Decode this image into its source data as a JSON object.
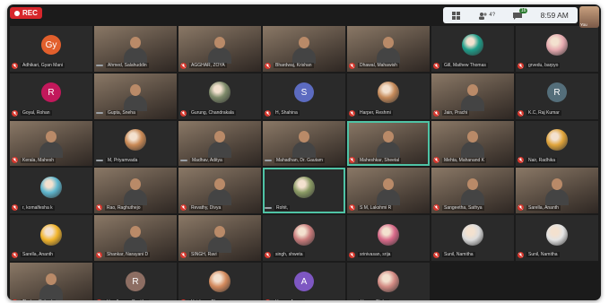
{
  "meeting": {
    "rec_label": "REC",
    "clock": "8:59 AM",
    "self_label": "You",
    "toolbar_icons": [
      "grid-view-icon",
      "participants-icon",
      "chat-icon"
    ],
    "participant_count": "4?",
    "chat_badge": "16"
  },
  "tiles": [
    {
      "name": "Adhikari, Gyan Mani",
      "type": "avatar",
      "initials": "Gy",
      "color": "#e25f2c",
      "muted": true
    },
    {
      "name": "Ahmed, Salahuddin",
      "type": "cam",
      "muted": false
    },
    {
      "name": "AGGHAR, ZOYA",
      "type": "cam",
      "muted": true
    },
    {
      "name": "Bhardwaj, Krishan",
      "type": "cam",
      "muted": true
    },
    {
      "name": "Dhawal, Mahawish",
      "type": "cam",
      "muted": true
    },
    {
      "name": "Gill, Mathew Thomas",
      "type": "picture",
      "color": "#1f9e8a",
      "muted": true
    },
    {
      "name": "grvedu, barpyo",
      "type": "picture",
      "color": "#e6aab0",
      "muted": true
    },
    {
      "name": "Goyal, Rohan",
      "type": "avatar",
      "initials": "R",
      "color": "#c2185b",
      "muted": true
    },
    {
      "name": "Gupta, Sneha",
      "type": "cam",
      "muted": false
    },
    {
      "name": "Gurung, Chandrakala",
      "type": "picture",
      "color": "#7d8a6a",
      "muted": true
    },
    {
      "name": "H, Shahina",
      "type": "avatar",
      "initials": "S",
      "color": "#5c6bc0",
      "muted": true
    },
    {
      "name": "Harper, Reshmi",
      "type": "picture",
      "color": "#c58a5a",
      "muted": true
    },
    {
      "name": "Jain, Prachi",
      "type": "cam",
      "muted": true
    },
    {
      "name": "K.C, Raj Kumar",
      "type": "avatar",
      "initials": "R",
      "color": "#546e7a",
      "muted": true
    },
    {
      "name": "Kerala, Mahesh",
      "type": "cam",
      "muted": true
    },
    {
      "name": "M, Priyamvada",
      "type": "picture",
      "color": "#c98955",
      "muted": false
    },
    {
      "name": "Madhav, Aditya",
      "type": "cam",
      "muted": false
    },
    {
      "name": "Mahadhan, Dr. Gautam",
      "type": "cam",
      "muted": false
    },
    {
      "name": "Maheshkar, Sheetal",
      "type": "cam",
      "muted": true,
      "highlight": true
    },
    {
      "name": "Mehta, Mahanand K",
      "type": "cam",
      "muted": true
    },
    {
      "name": "Nair, Radhika",
      "type": "picture",
      "color": "#e0a43a",
      "muted": true
    },
    {
      "name": "r, komalfesha k",
      "type": "picture",
      "color": "#5fb7cf",
      "muted": true
    },
    {
      "name": "Rao, Raghuthejo",
      "type": "cam",
      "muted": true
    },
    {
      "name": "Revathy, Divya",
      "type": "cam",
      "muted": true
    },
    {
      "name": "Rohit,",
      "type": "picture",
      "color": "#8a9a64",
      "muted": false,
      "highlight": true
    },
    {
      "name": "S M, Lakshmi R",
      "type": "cam",
      "muted": true
    },
    {
      "name": "Sangeetha, Sathya",
      "type": "cam",
      "muted": true
    },
    {
      "name": "Sarella, Ananth",
      "type": "cam",
      "muted": true
    },
    {
      "name": "Sarella, Ananth",
      "type": "picture",
      "color": "#f2b52c",
      "muted": true
    },
    {
      "name": "Shankar, Narayani D",
      "type": "cam",
      "muted": true
    },
    {
      "name": "SINGH, Ravi",
      "type": "cam",
      "muted": true
    },
    {
      "name": "singh, shweta",
      "type": "picture",
      "color": "#c87b7b",
      "muted": true
    },
    {
      "name": "srinivasan, srija",
      "type": "picture",
      "color": "#d86a8a",
      "muted": true
    },
    {
      "name": "Sunil, Namitha",
      "type": "picture",
      "color": "#dcdcdc",
      "muted": true
    },
    {
      "name": "Sunil, Namitha",
      "type": "picture",
      "color": "#e4e4e4",
      "muted": true
    },
    {
      "name": "Thakur, Rakesh",
      "type": "cam",
      "muted": true
    },
    {
      "name": "Upadhyaye, Renitha",
      "type": "avatar",
      "initials": "R",
      "color": "#8d6e63",
      "muted": true
    },
    {
      "name": "Vaishnav, Tharuna",
      "type": "picture",
      "color": "#d38a5d",
      "muted": true
    },
    {
      "name": "Verma, Anana",
      "type": "avatar",
      "initials": "A",
      "color": "#7e57c2",
      "muted": true
    },
    {
      "name": "Verma, Richa",
      "type": "picture",
      "color": "#d28a83",
      "muted": false
    }
  ]
}
